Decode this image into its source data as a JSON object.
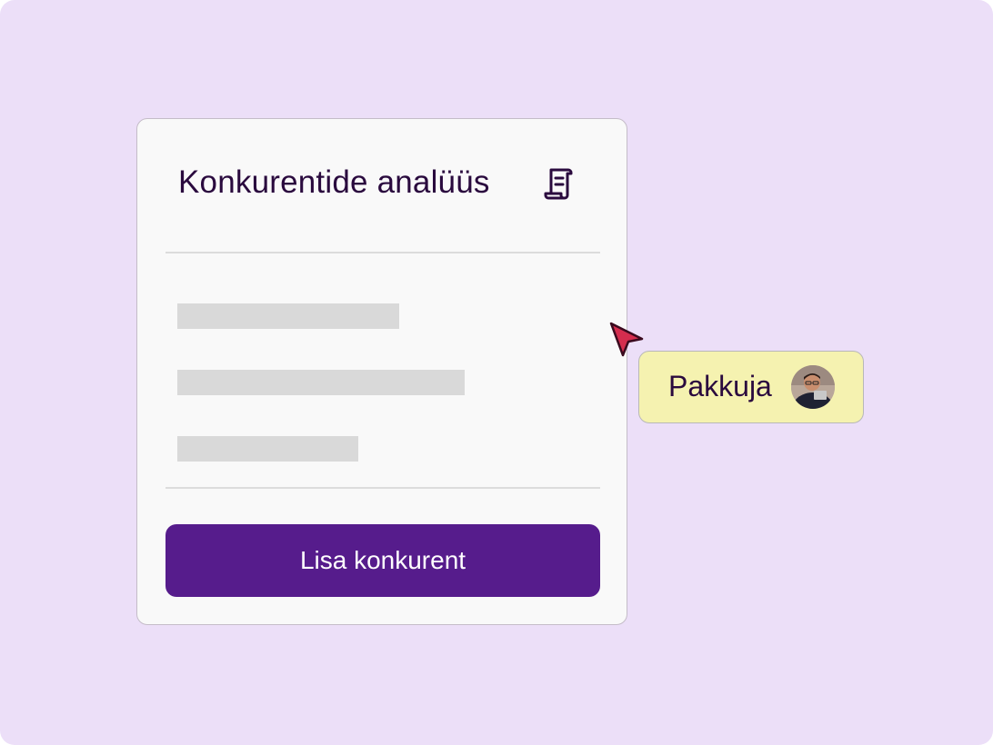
{
  "card": {
    "title": "Konkurentide analüüs",
    "title_icon": "document-icon",
    "skeleton_rows": 3,
    "button_label": "Lisa konkurent"
  },
  "cursor_tag": {
    "label": "Pakkuja",
    "cursor_icon": "pointer-arrow-icon",
    "avatar": "user-avatar"
  },
  "colors": {
    "background": "#ecdff8",
    "card": "#f9f9f9",
    "button": "#561c8c",
    "tag": "#f5f2b0",
    "cursor": "#d42d4e",
    "title_text": "#2a0a3e",
    "skeleton": "#d9d9d9"
  }
}
